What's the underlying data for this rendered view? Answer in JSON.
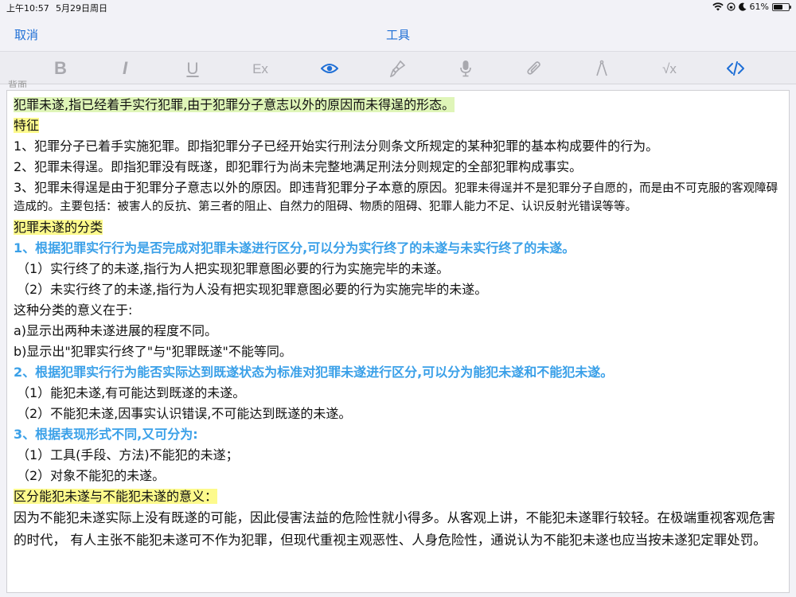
{
  "status": {
    "time": "上午10:57",
    "date": "5月29日周日",
    "battery": "61%",
    "battery_level": 0.61
  },
  "nav": {
    "cancel": "取消",
    "title": "工具"
  },
  "toolbar": {
    "tools": [
      {
        "name": "bold-button",
        "icon": "bold-icon",
        "glyph": "B",
        "active": false
      },
      {
        "name": "italic-button",
        "icon": "italic-icon",
        "glyph": "I",
        "active": false
      },
      {
        "name": "underline-button",
        "icon": "underline-icon",
        "glyph": "U",
        "active": false
      },
      {
        "name": "clear-format-button",
        "icon": "clear-format-icon",
        "glyph": "Ex",
        "active": false
      },
      {
        "name": "preview-button",
        "icon": "eye-icon",
        "active": true
      },
      {
        "name": "brush-button",
        "icon": "brush-icon",
        "active": false
      },
      {
        "name": "microphone-button",
        "icon": "microphone-icon",
        "active": false
      },
      {
        "name": "attachment-button",
        "icon": "paperclip-icon",
        "active": false
      },
      {
        "name": "compass-button",
        "icon": "compass-icon",
        "active": false
      },
      {
        "name": "math-button",
        "icon": "sqrt-icon",
        "glyph": "√x",
        "active": false
      },
      {
        "name": "code-button",
        "icon": "code-icon",
        "active": true
      }
    ],
    "accent": "#1f6fd6",
    "inactive": "#a8a8ae"
  },
  "subtitle": "背面",
  "colors": {
    "highlight_green": "#dff5b8",
    "highlight_yellow": "#fdfa8c",
    "heading_blue": "#3aa0e8"
  },
  "content": {
    "l1": "犯罪未遂,指已经着手实行犯罪,由于犯罪分子意志以外的原因而未得逞的形态。",
    "l2": "特征",
    "l3": "1、犯罪分子已着手实施犯罪。即指犯罪分子已经开始实行刑法分则条文所规定的某种犯罪的基本构成要件的行为。",
    "l4": "2、犯罪未得逞。即指犯罪没有既遂，即犯罪行为尚未完整地满足刑法分则规定的全部犯罪构成事实。",
    "l5a": "3、犯罪未得逞是由于犯罪分子意志以外的原因。即违背犯罪分子本意的原因。",
    "l5b": "犯罪未得逞并不是犯罪分子自愿的，而是由不可克服的客观障碍造成的。主要包括：被害人的反抗、第三者的阻止、自然力的阻碍、物质的阻碍、犯罪人能力不足、认识反射光错误等等。",
    "l6": "犯罪未遂的分类",
    "l7": "1、根据犯罪实行行为是否完成对犯罪未遂进行区分,可以分为实行终了的未遂与未实行终了的未遂。",
    "l8": "（1）实行终了的未遂,指行为人把实现犯罪意图必要的行为实施完毕的未遂。",
    "l9": "（2）未实行终了的未遂,指行为人没有把实现犯罪意图必要的行为实施完毕的未遂。",
    "l10": "这种分类的意义在于:",
    "l11": "a)显示出两种未遂进展的程度不同。",
    "l12": "b)显示出\"犯罪实行终了\"与\"犯罪既遂\"不能等同。",
    "l13": "2、根据犯罪实行行为能否实际达到既遂状态为标准对犯罪未遂进行区分,可以分为能犯未遂和不能犯未遂。",
    "l14": "（1）能犯未遂,有可能达到既遂的未遂。",
    "l15": "（2）不能犯未遂,因事实认识错误,不可能达到既遂的未遂。",
    "l16": "3、根据表现形式不同,又可分为:",
    "l17": "（1）工具(手段、方法)不能犯的未遂；",
    "l18": "（2）对象不能犯的未遂。",
    "l19": "区分能犯未遂与不能犯未遂的意义：",
    "l20": "因为不能犯未遂实际上没有既遂的可能，因此侵害法益的危险性就小得多。从客观上讲，不能犯未遂罪行较轻。在极端重视客观危害的时代， 有人主张不能犯未遂可不作为犯罪，但现代重视主观恶性、人身危险性，通说认为不能犯未遂也应当按未遂犯定罪处罚。"
  }
}
